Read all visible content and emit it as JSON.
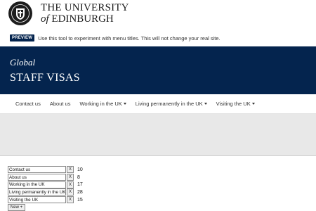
{
  "brand": {
    "line1": "THE UNIVERSITY",
    "of": "of",
    "line2": "EDINBURGH",
    "crest_icon": "university-crest-icon"
  },
  "preview": {
    "badge": "PREVIEW",
    "message": "Use this tool to experiment with menu titles. This will not change your real site."
  },
  "hero": {
    "subtitle": "Global",
    "title": "STAFF VISAS"
  },
  "nav": {
    "items": [
      {
        "label": "Contact us",
        "dropdown": false
      },
      {
        "label": "About us",
        "dropdown": false
      },
      {
        "label": "Working in the UK",
        "dropdown": true
      },
      {
        "label": "Living permanently in the UK",
        "dropdown": true
      },
      {
        "label": "Visiting the UK",
        "dropdown": true
      }
    ]
  },
  "editor": {
    "rows": [
      {
        "value": "Contact us",
        "remove": "X",
        "count": "10"
      },
      {
        "value": "About us",
        "remove": "X",
        "count": "8"
      },
      {
        "value": "Working in the UK",
        "remove": "X",
        "count": "17"
      },
      {
        "value": "Living permanently in the UK",
        "remove": "X",
        "count": "28"
      },
      {
        "value": "Visiting the UK",
        "remove": "X",
        "count": "15"
      }
    ],
    "new_label": "New +"
  },
  "colors": {
    "brand_navy": "#04244e",
    "grey_band": "#e8e8e8"
  }
}
